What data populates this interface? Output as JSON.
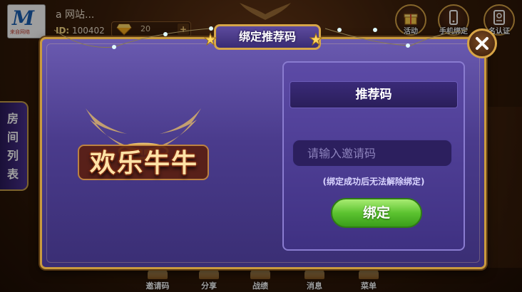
{
  "player": {
    "name": "a 网站...",
    "id_label": "ID:",
    "id_value": "100402",
    "diamond_count": "20",
    "diamond_plus": "+"
  },
  "logo": {
    "mark": "M",
    "caption": "来自网络"
  },
  "top_buttons": [
    {
      "label": "活动",
      "icon": "gift-icon"
    },
    {
      "label": "手机绑定",
      "icon": "phone-icon"
    },
    {
      "label": "名认证",
      "icon": "id-card-icon"
    }
  ],
  "side_tab": {
    "label": "房间列表"
  },
  "modal": {
    "title": "绑定推荐码",
    "game_logo": "欢乐牛牛",
    "panel_title": "推荐码",
    "input_placeholder": "请输入邀请码",
    "input_value": "",
    "note": "(绑定成功后无法解除绑定)",
    "bind_button": "绑定"
  },
  "bottom_nav": [
    {
      "label": "邀请码"
    },
    {
      "label": "分享"
    },
    {
      "label": "战绩"
    },
    {
      "label": "消息"
    },
    {
      "label": "菜单"
    }
  ],
  "colors": {
    "modal_bg": "#4a3b8c",
    "frame_gold": "#c99a3e",
    "bind_green": "#5cc330"
  }
}
